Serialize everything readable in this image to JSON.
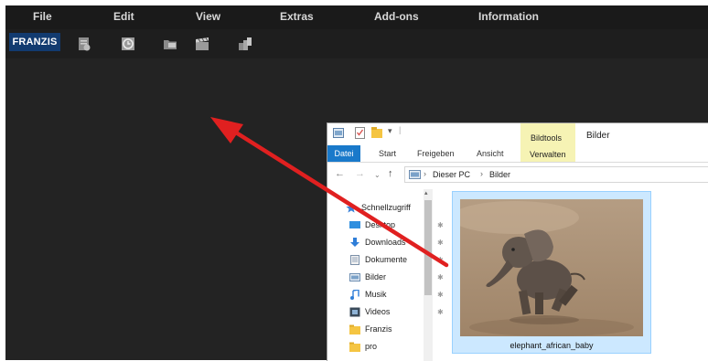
{
  "app": {
    "menu": [
      "File",
      "Edit",
      "View",
      "Extras",
      "Add-ons",
      "Information"
    ],
    "logo": "FRANZIS",
    "toolbar_icons": [
      "open-file-icon",
      "history-icon",
      "folder-open-icon",
      "clapperboard-icon",
      "batch-icon"
    ]
  },
  "explorer": {
    "ribbon": {
      "context_group": "Bildtools",
      "context_title": "Bilder",
      "context_tab": "Verwalten",
      "tabs": [
        "Datei",
        "Start",
        "Freigeben",
        "Ansicht"
      ]
    },
    "address": [
      "Dieser PC",
      "Bilder"
    ],
    "nav_items": [
      {
        "label": "Schnellzugriff",
        "icon": "star-icon",
        "pinned": false
      },
      {
        "label": "Desktop",
        "icon": "desktop-icon",
        "pinned": true
      },
      {
        "label": "Downloads",
        "icon": "download-icon",
        "pinned": true
      },
      {
        "label": "Dokumente",
        "icon": "documents-icon",
        "pinned": true
      },
      {
        "label": "Bilder",
        "icon": "pictures-icon",
        "pinned": true
      },
      {
        "label": "Musik",
        "icon": "music-icon",
        "pinned": true
      },
      {
        "label": "Videos",
        "icon": "videos-icon",
        "pinned": true
      },
      {
        "label": "Franzis",
        "icon": "folder-icon",
        "pinned": false
      },
      {
        "label": "pro",
        "icon": "folder-icon",
        "pinned": false
      }
    ],
    "file": {
      "name": "elephant_african_baby",
      "selected": true
    }
  },
  "colors": {
    "accent": "#1979ca",
    "arrow": "#e02020",
    "selection": "#cce8ff",
    "context_tab": "#f6f3b4"
  }
}
